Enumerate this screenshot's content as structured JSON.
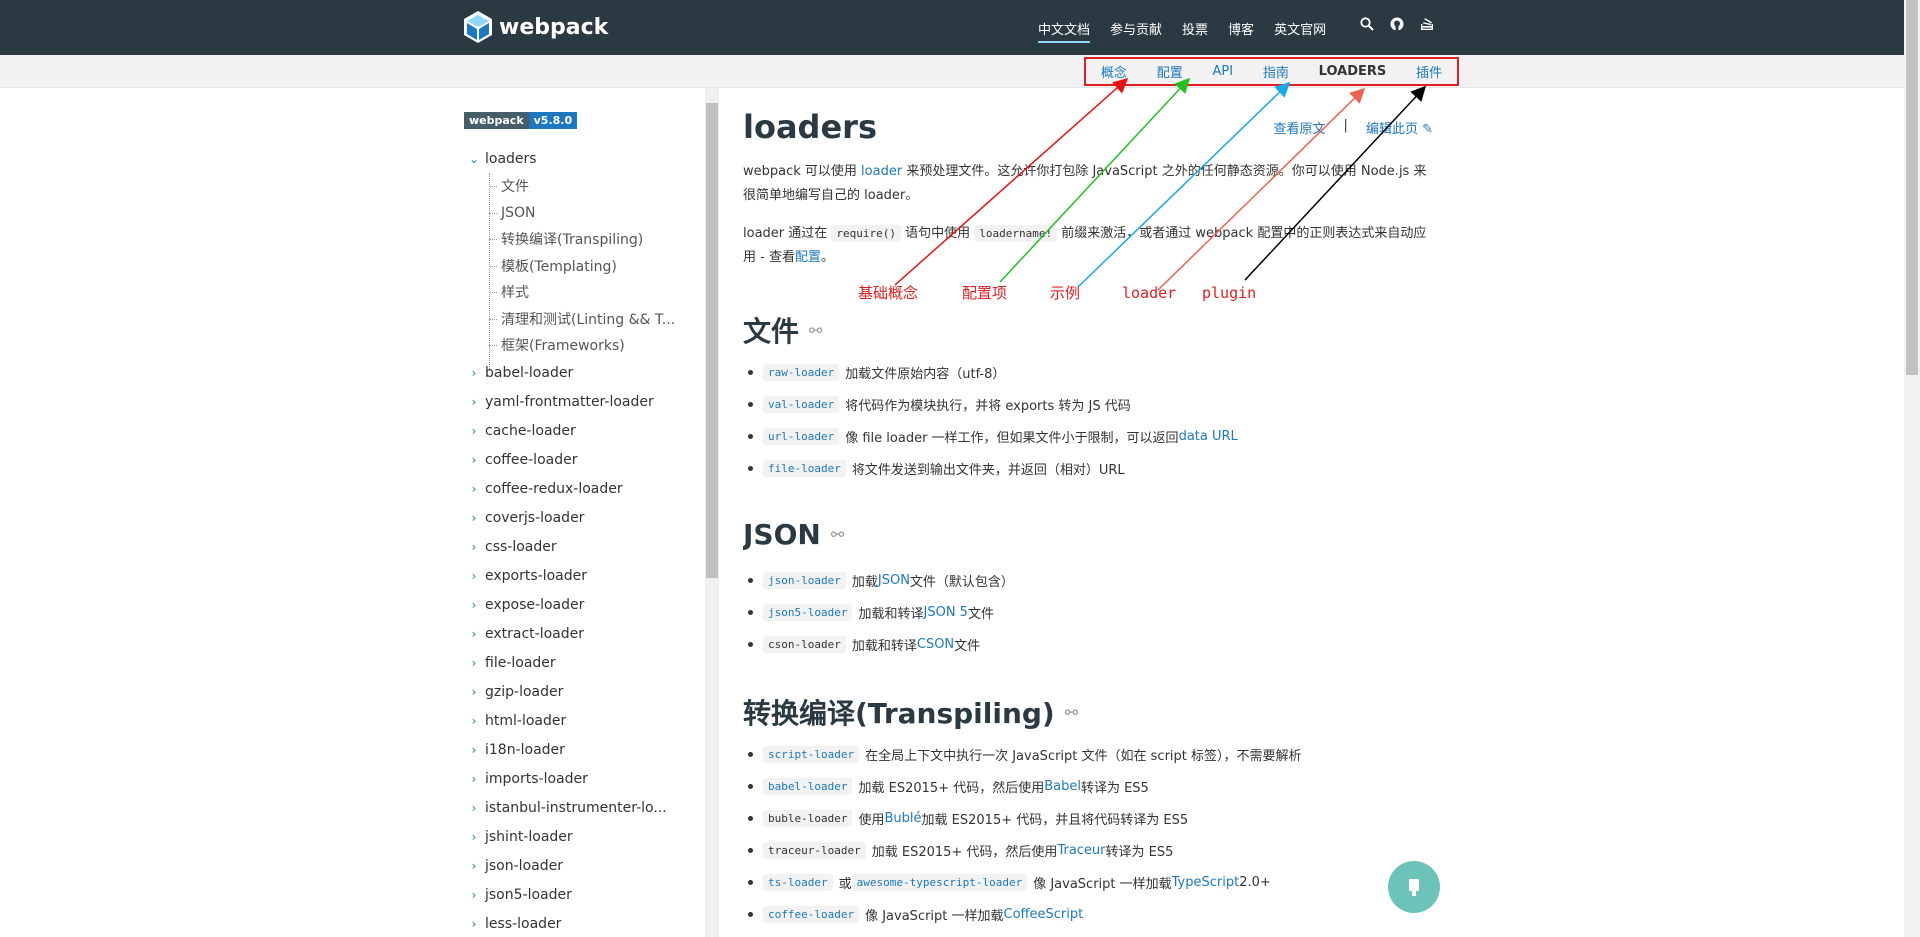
{
  "header": {
    "logo_text": "webpack",
    "nav": [
      "中文文档",
      "参与贡献",
      "投票",
      "博客",
      "英文官网"
    ],
    "icons": [
      "search-icon",
      "github-icon",
      "stackoverflow-icon"
    ]
  },
  "subnav": {
    "items": [
      "概念",
      "配置",
      "API",
      "指南",
      "LOADERS",
      "插件"
    ],
    "current": "LOADERS"
  },
  "sidebar": {
    "badge_name": "webpack",
    "badge_version": "v5.8.0",
    "open_section": "loaders",
    "children": [
      "文件",
      "JSON",
      "转换编译(Transpiling)",
      "模板(Templating)",
      "样式",
      "清理和测试(Linting && T...",
      "框架(Frameworks)"
    ],
    "items": [
      "babel-loader",
      "yaml-frontmatter-loader",
      "cache-loader",
      "coffee-loader",
      "coffee-redux-loader",
      "coverjs-loader",
      "css-loader",
      "exports-loader",
      "expose-loader",
      "extract-loader",
      "file-loader",
      "gzip-loader",
      "html-loader",
      "i18n-loader",
      "imports-loader",
      "istanbul-instrumenter-lo...",
      "jshint-loader",
      "json-loader",
      "json5-loader",
      "less-loader"
    ]
  },
  "main": {
    "title": "loaders",
    "view_source": "查看原文",
    "separator": "|",
    "edit_page": "编辑此页",
    "p1": {
      "a": "webpack 可以使用 ",
      "link": "loader",
      "b": " 来预处理文件。这允许你打包除 JavaScript 之外的任何静态资源。你可以使用 Node.js 来很简单地编写自己的 loader。"
    },
    "p2": {
      "a": "loader 通过在 ",
      "code1": "require()",
      "b": " 语句中使用 ",
      "code2": "loadername!",
      "c": " 前缀来激活，或者通过 webpack 配置中的正则表达式来自动应用 - 查看",
      "link": "配置",
      "d": "。"
    },
    "sections": [
      {
        "title": "文件",
        "items": [
          {
            "code": "raw-loader",
            "text": "加载文件原始内容（utf-8）",
            "link": "",
            "after": ""
          },
          {
            "code": "val-loader",
            "text": "将代码作为模块执行，并将 exports 转为 JS 代码",
            "link": "",
            "after": ""
          },
          {
            "code": "url-loader",
            "text": "像 file loader 一样工作，但如果文件小于限制，可以返回 ",
            "link": "data URL",
            "after": ""
          },
          {
            "code": "file-loader",
            "text": "将文件发送到输出文件夹，并返回（相对）URL",
            "link": "",
            "after": ""
          }
        ]
      },
      {
        "title": "JSON",
        "items": [
          {
            "code": "json-loader",
            "text": "加载 ",
            "link": "JSON",
            "after": " 文件（默认包含）"
          },
          {
            "code": "json5-loader",
            "text": "加载和转译 ",
            "link": "JSON 5",
            "after": " 文件"
          },
          {
            "code": "cson-loader",
            "text": "加载和转译 ",
            "link": "CSON",
            "after": " 文件"
          }
        ]
      },
      {
        "title": "转换编译(Transpiling)",
        "items": [
          {
            "code": "script-loader",
            "text": "在全局上下文中执行一次 JavaScript 文件（如在 script 标签），不需要解析",
            "link": "",
            "after": ""
          },
          {
            "code": "babel-loader",
            "text": "加载 ES2015+ 代码，然后使用 ",
            "link": "Babel",
            "after": " 转译为 ES5"
          },
          {
            "code": "buble-loader",
            "text": "使用 ",
            "link": "Bublé",
            "after": " 加载 ES2015+ 代码，并且将代码转译为 ES5"
          },
          {
            "code": "traceur-loader",
            "text": "加载 ES2015+ 代码，然后使用 ",
            "link": "Traceur",
            "after": " 转译为 ES5"
          },
          {
            "code": "ts-loader",
            "text": "或",
            "code2": "awesome-typescript-loader",
            "text2": "像 JavaScript 一样加载 ",
            "link": "TypeScript",
            "after": " 2.0+"
          },
          {
            "code": "coffee-loader",
            "text": "像 JavaScript 一样加载 ",
            "link": "CoffeeScript",
            "after": ""
          }
        ]
      }
    ]
  },
  "annotations": [
    {
      "text": "基础概念",
      "color": "#e02020"
    },
    {
      "text": "配置项",
      "color": "#e02020"
    },
    {
      "text": "示例",
      "color": "#e02020"
    },
    {
      "text": "loader",
      "color": "#e02020"
    },
    {
      "text": "plugin",
      "color": "#e02020"
    }
  ],
  "arrow_colors": [
    "#e81010",
    "#22c022",
    "#18a8e8",
    "#f06050",
    "#000000"
  ],
  "highlight_color": "#e02020"
}
